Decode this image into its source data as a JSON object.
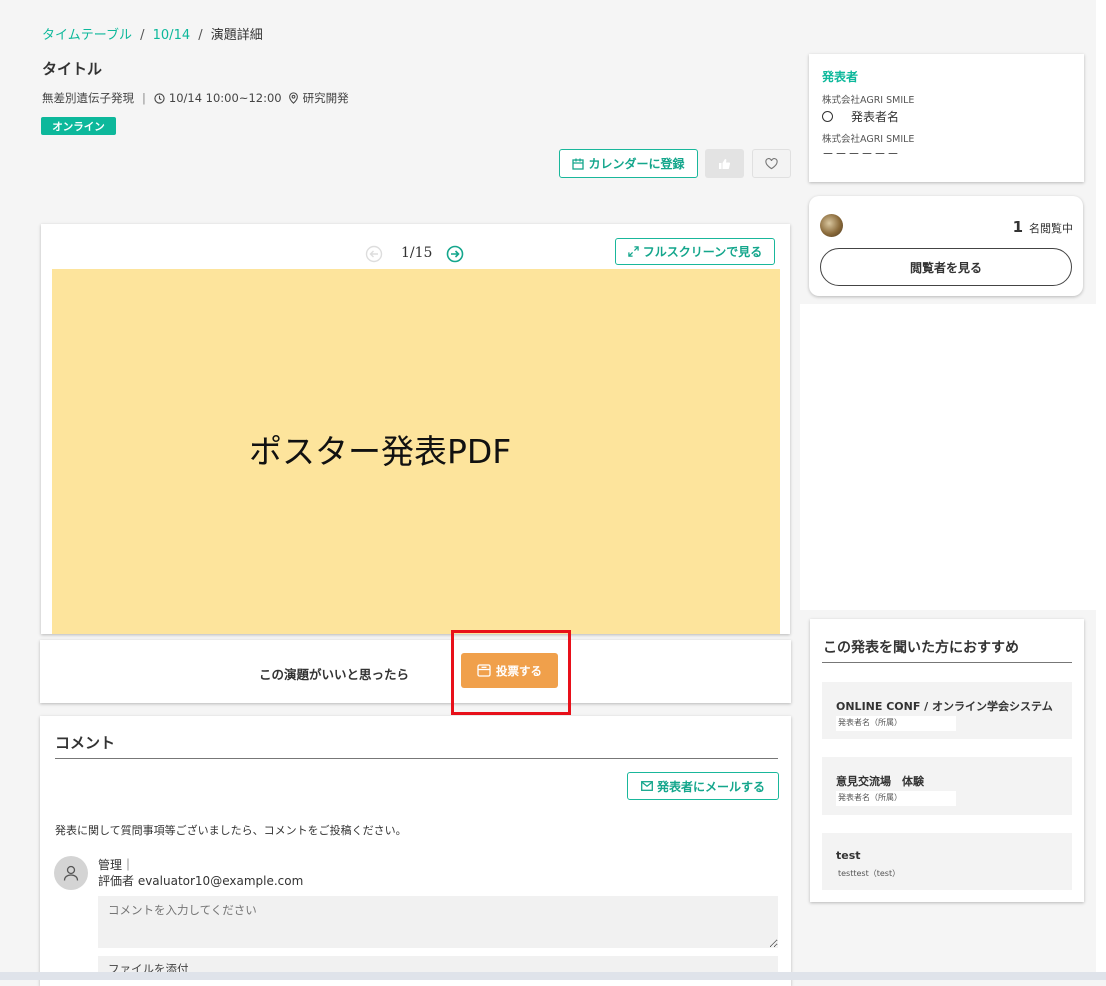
{
  "breadcrumb": {
    "items": [
      "タイムテーブル",
      "10/14",
      "演題詳細"
    ],
    "separator": "/"
  },
  "presentation": {
    "title": "タイトル",
    "category": "無差別遺伝子発現",
    "datetime": "10/14 10:00~12:00",
    "location": "研究開発",
    "badge": "オンライン"
  },
  "actions": {
    "calendar_label": "カレンダーに登録"
  },
  "viewer": {
    "page_indicator": "1/15",
    "fullscreen_label": "フルスクリーンで見る",
    "poster_text": "ポスター発表PDF"
  },
  "vote": {
    "prompt": "この演題がいいと思ったら",
    "button_label": "投票する"
  },
  "comments": {
    "heading": "コメント",
    "mail_button": "発表者にメールする",
    "note": "発表に関して質問事項等ございましたら、コメントをご投稿ください。",
    "user_name": "管理｜",
    "user_role": "評価者 evaluator10@example.com",
    "input_placeholder": "コメントを入力してください",
    "attach_label": "ファイルを添付"
  },
  "presenters": {
    "heading": "発表者",
    "org1": "株式会社AGRI SMILE",
    "presenter1": "発表者名",
    "org2": "株式会社AGRI SMILE",
    "presenter2": "－－－－－－"
  },
  "viewers": {
    "count": "1",
    "suffix": "名閲覧中",
    "button_label": "閲覧者を見る"
  },
  "recommendations": {
    "heading": "この発表を聞いた方におすすめ",
    "items": [
      {
        "title": "ONLINE CONF / オンライン学会システム",
        "subtitle": "発表者名（所属）"
      },
      {
        "title": "意見交流場　体験",
        "subtitle": "発表者名（所属）"
      },
      {
        "title": "test",
        "subtitle": "testtest（test）"
      }
    ]
  },
  "colors": {
    "accent": "#0db89b",
    "vote_button": "#f0a04b",
    "poster_bg": "#fde49c",
    "highlight_box": "#e8101a"
  }
}
